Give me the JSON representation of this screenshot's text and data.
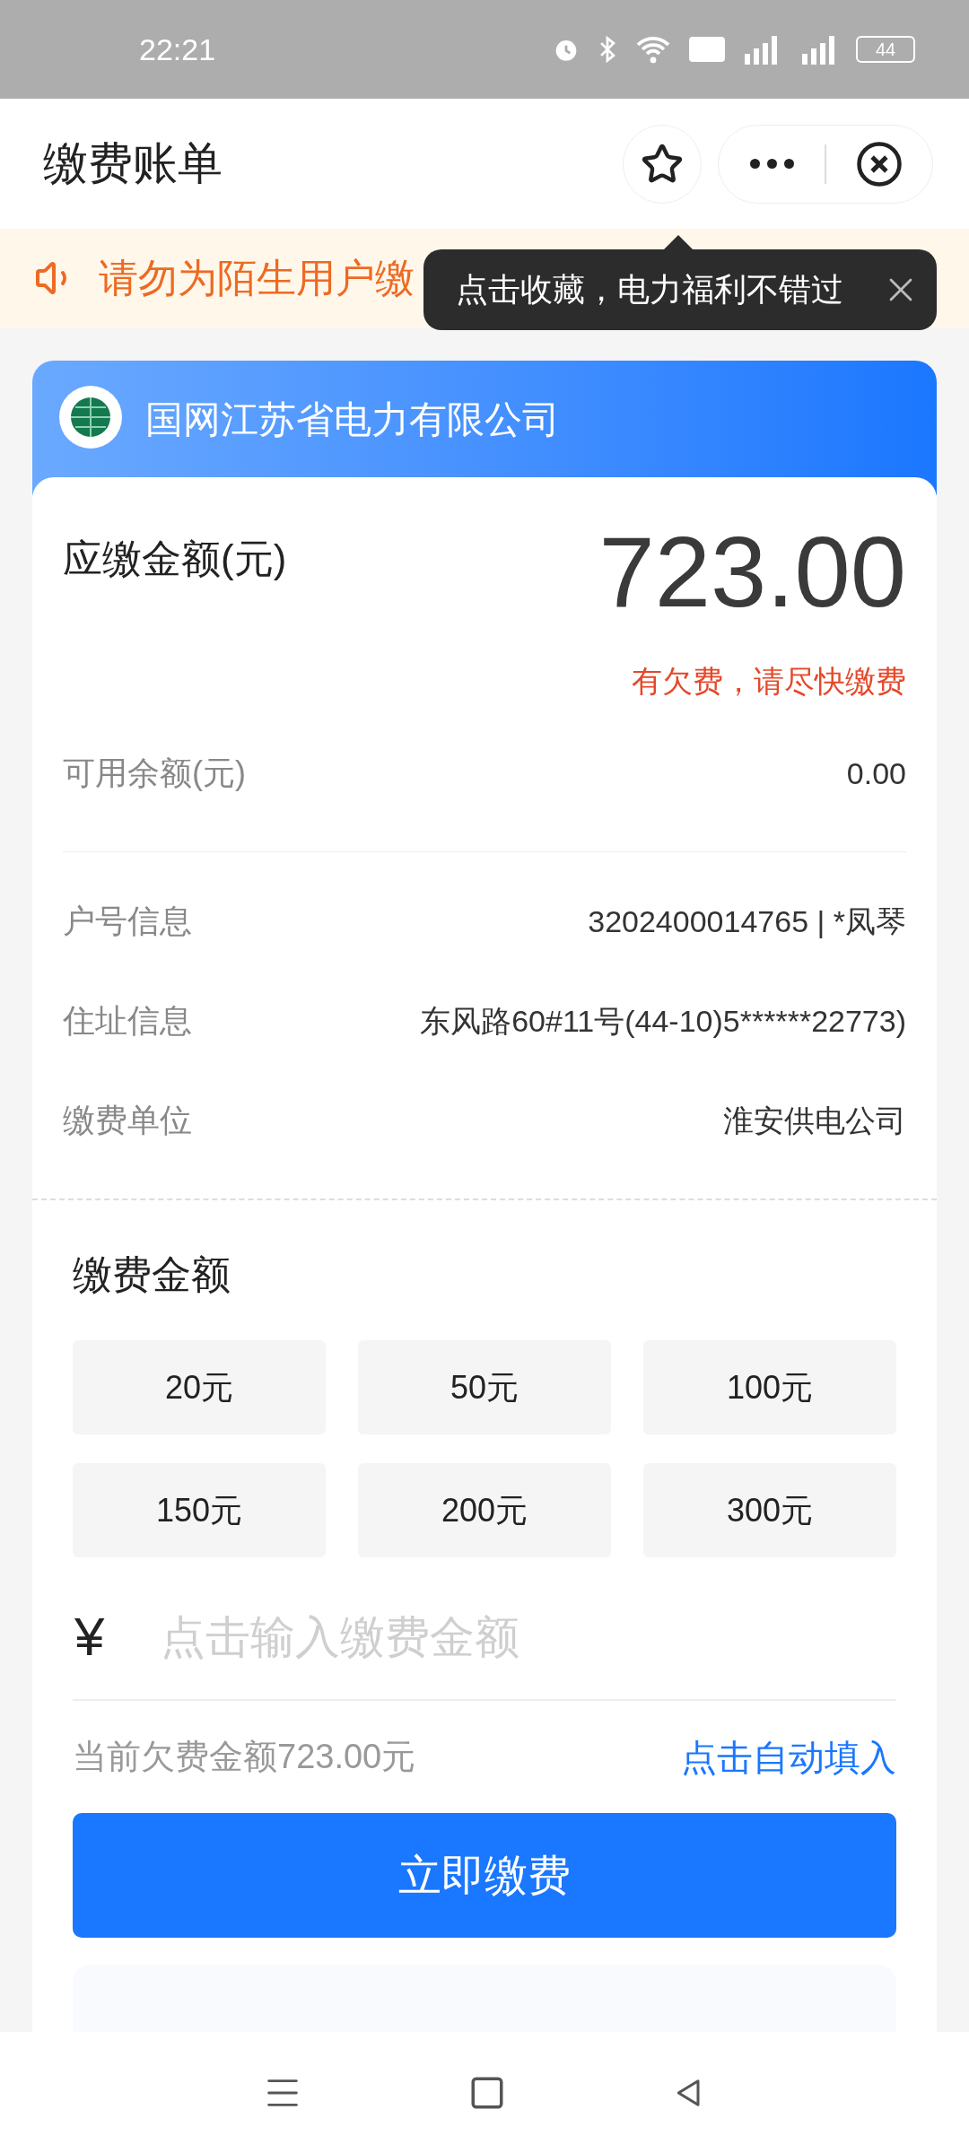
{
  "status_bar": {
    "time": "22:21",
    "battery": "44"
  },
  "header": {
    "title": "缴费账单"
  },
  "notice": {
    "text": "请勿为陌生用户缴"
  },
  "tooltip": {
    "text": "点击收藏，电力福利不错过"
  },
  "company": {
    "name": "国网江苏省电力有限公司"
  },
  "bill": {
    "label": "应缴金额(元)",
    "amount": "723.00",
    "warning": "有欠费，请尽快缴费",
    "balance_label": "可用余额(元)",
    "balance": "0.00"
  },
  "info_rows": [
    {
      "label": "户号信息",
      "value": "3202400014765 | *凤琴"
    },
    {
      "label": "住址信息",
      "value": "东风路60#11号(44-10)5******22773)"
    },
    {
      "label": "缴费单位",
      "value": "淮安供电公司"
    }
  ],
  "payment": {
    "title": "缴费金额",
    "options": [
      {
        "label": "20元",
        "selected": false
      },
      {
        "label": "50元",
        "selected": false
      },
      {
        "label": "100元",
        "selected": false
      },
      {
        "label": "150元",
        "selected": false
      },
      {
        "label": "200元",
        "selected": false
      },
      {
        "label": "300元",
        "selected": false
      }
    ],
    "currency": "¥",
    "placeholder": "点击输入缴费金额",
    "arrears_hint": "当前欠费金额723.00元",
    "autofill_link": "点击自动填入",
    "pay_button": "立即缴费"
  }
}
